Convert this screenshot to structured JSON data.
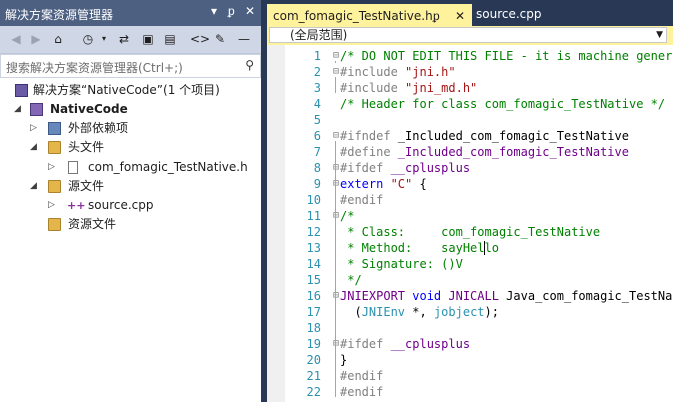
{
  "explorer": {
    "title": "解决方案资源管理器",
    "title_controls": [
      "▾",
      "ᵱ",
      "✕"
    ],
    "search_placeholder": "搜索解决方案资源管理器(Ctrl+;)",
    "tree": [
      {
        "label": "解决方案“NativeCode”(1 个项目)",
        "icon": "solution-icon",
        "level": 0,
        "expanded": null
      },
      {
        "label": "NativeCode",
        "icon": "project-icon",
        "level": 0,
        "expanded": true,
        "bold": true
      },
      {
        "label": "外部依赖项",
        "icon": "references-icon",
        "level": 1,
        "expanded": false
      },
      {
        "label": "头文件",
        "icon": "folder-icon",
        "level": 1,
        "expanded": true
      },
      {
        "label": "com_fomagic_TestNative.h",
        "icon": "header-file-icon",
        "level": 2,
        "expanded": false
      },
      {
        "label": "源文件",
        "icon": "folder-icon",
        "level": 1,
        "expanded": true
      },
      {
        "label": "source.cpp",
        "icon": "cpp-file-icon",
        "level": 2,
        "expanded": false
      },
      {
        "label": "资源文件",
        "icon": "folder-icon",
        "level": 1,
        "expanded": null
      }
    ]
  },
  "tabs": [
    {
      "label": "com_fomagic_TestNative.h",
      "active": true,
      "pin": "ᵱ",
      "close": "✕"
    },
    {
      "label": "source.cpp",
      "active": false
    }
  ],
  "editor": {
    "scope": "(全局范围)",
    "lines": [
      {
        "n": "1",
        "fold": "⊟",
        "segs": [
          [
            "c-com",
            "/* DO NOT EDIT THIS FILE - it is machine generat"
          ]
        ]
      },
      {
        "n": "2",
        "fold": "⊟",
        "segs": [
          [
            "c-pp",
            "#include "
          ],
          [
            "c-str",
            "\"jni.h\""
          ]
        ]
      },
      {
        "n": "3",
        "fold": "",
        "segs": [
          [
            "c-pp",
            "#include "
          ],
          [
            "c-str",
            "\"jni_md.h\""
          ]
        ]
      },
      {
        "n": "4",
        "fold": "",
        "segs": [
          [
            "c-com",
            "/* Header for class com_fomagic_TestNative */"
          ]
        ]
      },
      {
        "n": "5",
        "fold": "",
        "segs": []
      },
      {
        "n": "6",
        "fold": "⊟",
        "segs": [
          [
            "c-pp",
            "#ifndef "
          ],
          [
            "",
            "_Included_com_fomagic_TestNative"
          ]
        ]
      },
      {
        "n": "7",
        "fold": "",
        "segs": [
          [
            "c-pp",
            "#define "
          ],
          [
            "c-mac",
            "_Included_com_fomagic_TestNative"
          ]
        ]
      },
      {
        "n": "8",
        "fold": "⊟",
        "segs": [
          [
            "c-pp",
            "#ifdef "
          ],
          [
            "c-mac",
            "__cplusplus"
          ]
        ]
      },
      {
        "n": "9",
        "fold": "⊟",
        "segs": [
          [
            "c-kw",
            "extern "
          ],
          [
            "c-str",
            "\"C\""
          ],
          [
            "",
            " {"
          ]
        ]
      },
      {
        "n": "10",
        "fold": "",
        "segs": [
          [
            "c-pp",
            "#endif"
          ]
        ]
      },
      {
        "n": "11",
        "fold": "⊟",
        "segs": [
          [
            "c-com",
            "/*"
          ]
        ]
      },
      {
        "n": "12",
        "fold": "",
        "segs": [
          [
            "c-com",
            " * Class:     com_fomagic_TestNative"
          ]
        ]
      },
      {
        "n": "13",
        "fold": "",
        "segs": [
          [
            "c-com",
            " * Method:    sayHello"
          ]
        ]
      },
      {
        "n": "14",
        "fold": "",
        "segs": [
          [
            "c-com",
            " * Signature: ()V"
          ]
        ]
      },
      {
        "n": "15",
        "fold": "",
        "segs": [
          [
            "c-com",
            " */"
          ]
        ]
      },
      {
        "n": "16",
        "fold": "⊟",
        "segs": [
          [
            "c-mac",
            "JNIEXPORT "
          ],
          [
            "c-kw",
            "void "
          ],
          [
            "c-mac",
            "JNICALL "
          ],
          [
            "",
            "Java_com_fomagic_TestNati"
          ]
        ]
      },
      {
        "n": "17",
        "fold": "",
        "segs": [
          [
            "",
            "  ("
          ],
          [
            "c-typ",
            "JNIEnv"
          ],
          [
            "",
            " *, "
          ],
          [
            "c-typ",
            "jobject"
          ],
          [
            "",
            ");"
          ]
        ]
      },
      {
        "n": "18",
        "fold": "",
        "segs": []
      },
      {
        "n": "19",
        "fold": "⊟",
        "segs": [
          [
            "c-pp",
            "#ifdef "
          ],
          [
            "c-mac",
            "__cplusplus"
          ]
        ]
      },
      {
        "n": "20",
        "fold": "",
        "segs": [
          [
            "",
            "}"
          ]
        ]
      },
      {
        "n": "21",
        "fold": "",
        "segs": [
          [
            "c-pp",
            "#endif"
          ]
        ]
      },
      {
        "n": "22",
        "fold": "",
        "segs": [
          [
            "c-pp",
            "#endif"
          ]
        ]
      }
    ]
  }
}
